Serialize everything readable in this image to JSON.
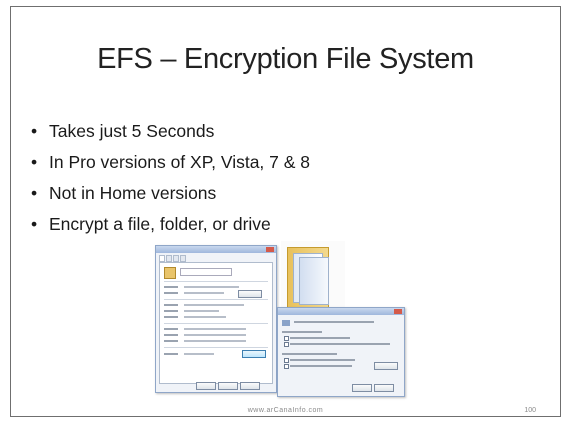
{
  "slide": {
    "title": "EFS – Encryption File System",
    "bullets": [
      "Takes just 5 Seconds",
      "In Pro versions of XP, Vista, 7 & 8",
      "Not in Home versions",
      "Encrypt a file, folder, or drive"
    ],
    "footer_url": "www.arCanaInfo.com",
    "page_number": "100"
  },
  "screenshot": {
    "properties_dialog_tabs": [
      "General",
      "Security",
      "Details",
      "Previous Versions"
    ],
    "advanced_dialog": "Advanced Attributes",
    "icons": [
      "folder-icon",
      "file-icon"
    ]
  }
}
